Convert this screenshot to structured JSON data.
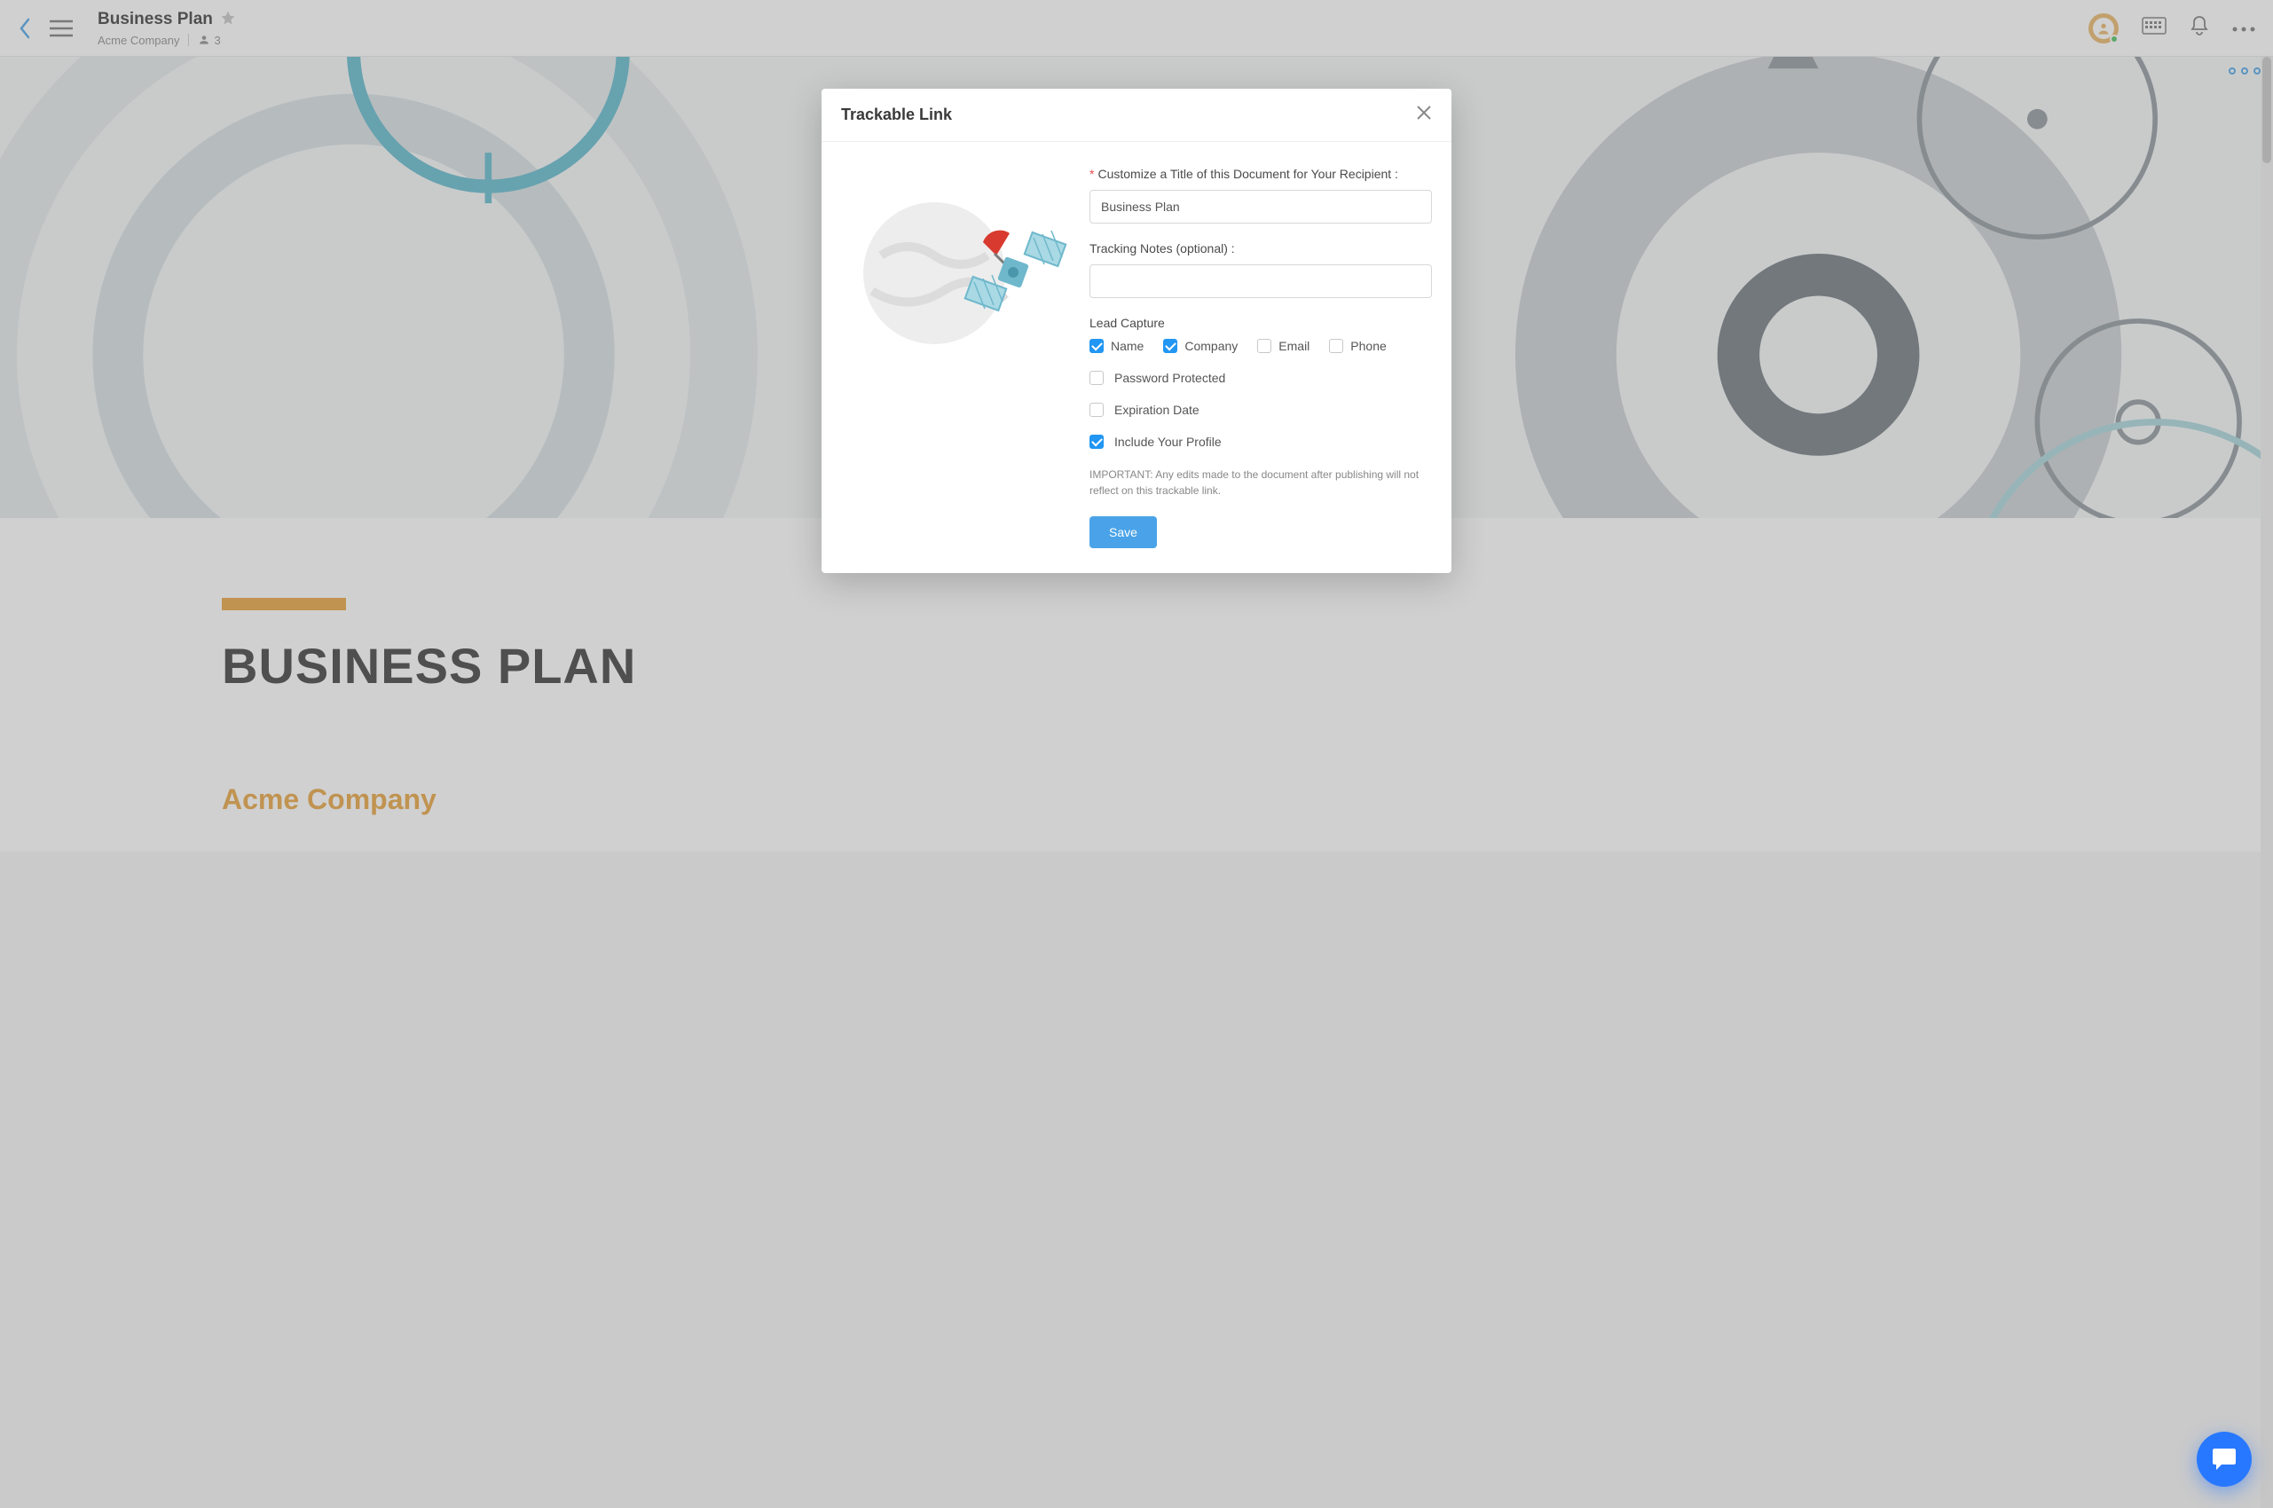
{
  "header": {
    "doc_title": "Business Plan",
    "company": "Acme Company",
    "share_count": "3"
  },
  "document": {
    "big_title": "BUSINESS PLAN",
    "company_heading": "Acme Company"
  },
  "modal": {
    "title": "Trackable Link",
    "title_field_label": "Customize a Title of this Document for Your Recipient :",
    "title_field_value": "Business Plan",
    "notes_label": "Tracking Notes (optional) :",
    "notes_value": "",
    "lead_capture_label": "Lead Capture",
    "lead_options": [
      {
        "label": "Name",
        "checked": true
      },
      {
        "label": "Company",
        "checked": true
      },
      {
        "label": "Email",
        "checked": false
      },
      {
        "label": "Phone",
        "checked": false
      }
    ],
    "password_label": "Password Protected",
    "password_checked": false,
    "expiration_label": "Expiration Date",
    "expiration_checked": false,
    "include_profile_label": "Include Your Profile",
    "include_profile_checked": true,
    "important_note": "IMPORTANT: Any edits made to the document after publishing will not reflect on this trackable link.",
    "save_label": "Save"
  }
}
